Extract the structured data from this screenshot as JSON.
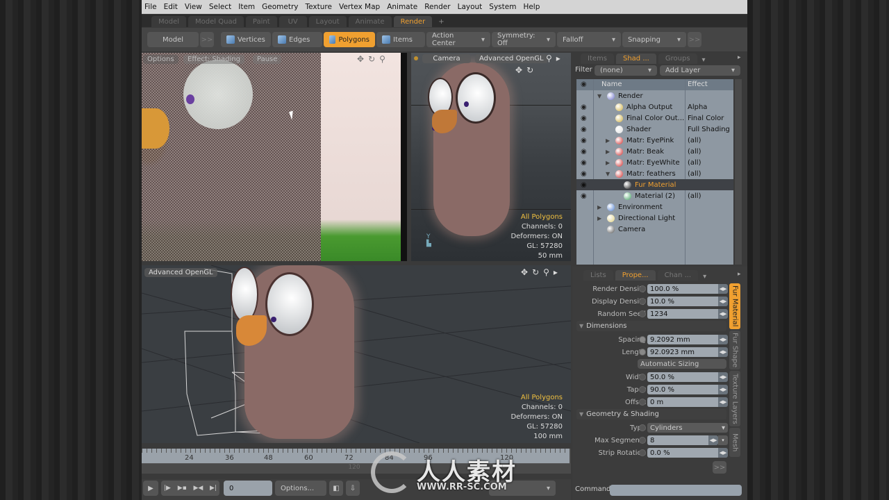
{
  "menu": [
    "File",
    "Edit",
    "View",
    "Select",
    "Item",
    "Geometry",
    "Texture",
    "Vertex Map",
    "Animate",
    "Render",
    "Layout",
    "System",
    "Help"
  ],
  "layout_tabs": [
    {
      "label": "Model",
      "active": false
    },
    {
      "label": "Model Quad",
      "active": false
    },
    {
      "label": "Paint",
      "active": false
    },
    {
      "label": "UV",
      "active": false
    },
    {
      "label": "Layout",
      "active": false
    },
    {
      "label": "Animate",
      "active": false
    },
    {
      "label": "Render",
      "active": true
    }
  ],
  "layout_tab_add": "+",
  "toolbar": {
    "model": "Model",
    "more": ">>",
    "vertices": "Vertices",
    "edges": "Edges",
    "polygons": "Polygons",
    "items": "Items",
    "action_center": "Action Center",
    "symmetry": "Symmetry: Off",
    "falloff": "Falloff",
    "snapping": "Snapping",
    "more2": ">>"
  },
  "preview_vp": {
    "options": "Options",
    "effect": "Effect: Shading",
    "pause": "Pause"
  },
  "camera_vp": {
    "camera": "Camera",
    "mode": "Advanced OpenGL",
    "hud": {
      "selection": "All Polygons",
      "channels": "Channels: 0",
      "deformers": "Deformers: ON",
      "gl": "GL: 57280",
      "scale": "50 mm"
    }
  },
  "persp_vp": {
    "mode": "Advanced OpenGL",
    "hud": {
      "selection": "All Polygons",
      "channels": "Channels: 0",
      "deformers": "Deformers: ON",
      "gl": "GL: 57280",
      "scale": "100 mm"
    }
  },
  "shader_panel": {
    "tabs": [
      {
        "label": "Items",
        "active": false
      },
      {
        "label": "Shad ...",
        "active": true
      },
      {
        "label": "Groups",
        "active": false
      }
    ],
    "filter_label": "Filter",
    "filter_value": "(none)",
    "add_layer": "Add Layer",
    "col_name": "Name",
    "col_effect": "Effect",
    "rows": [
      {
        "name": "Render",
        "effect": "",
        "indent": 0,
        "arrow": "▼",
        "icon": "#6a70c8",
        "eye": false,
        "sel": false
      },
      {
        "name": "Alpha Output",
        "effect": "Alpha",
        "indent": 1,
        "arrow": "",
        "icon": "#d0b040",
        "eye": true,
        "sel": false
      },
      {
        "name": "Final Color Out...",
        "effect": "Final Color",
        "indent": 1,
        "arrow": "",
        "icon": "#d0b040",
        "eye": true,
        "sel": false
      },
      {
        "name": "Shader",
        "effect": "Full Shading",
        "indent": 1,
        "arrow": "",
        "icon": "#e0e0e0",
        "eye": true,
        "sel": false
      },
      {
        "name": "Matr: EyePink",
        "effect": "(all)",
        "indent": 1,
        "arrow": "▶",
        "icon": "#d03030",
        "eye": true,
        "sel": false
      },
      {
        "name": "Matr: Beak",
        "effect": "(all)",
        "indent": 1,
        "arrow": "▶",
        "icon": "#d03030",
        "eye": true,
        "sel": false
      },
      {
        "name": "Matr: EyeWhite",
        "effect": "(all)",
        "indent": 1,
        "arrow": "▶",
        "icon": "#d03030",
        "eye": true,
        "sel": false
      },
      {
        "name": "Matr: feathers",
        "effect": "(all)",
        "indent": 1,
        "arrow": "▼",
        "icon": "#d03030",
        "eye": true,
        "sel": false
      },
      {
        "name": "Fur Material",
        "effect": "",
        "indent": 2,
        "arrow": "",
        "icon": "#222222",
        "eye": true,
        "sel": true
      },
      {
        "name": "Material (2)",
        "effect": "(all)",
        "indent": 2,
        "arrow": "",
        "icon": "#40a060",
        "eye": true,
        "sel": false
      },
      {
        "name": "Environment",
        "effect": "",
        "indent": 0,
        "arrow": "▶",
        "icon": "#5080d0",
        "eye": false,
        "sel": false
      },
      {
        "name": "Directional Light",
        "effect": "",
        "indent": 0,
        "arrow": "▶",
        "icon": "#e0d080",
        "eye": false,
        "sel": false
      },
      {
        "name": "Camera",
        "effect": "",
        "indent": 0,
        "arrow": "",
        "icon": "#555555",
        "eye": false,
        "sel": false
      }
    ]
  },
  "props_panel": {
    "tabs": [
      {
        "label": "Lists",
        "active": false
      },
      {
        "label": "Prope...",
        "active": true
      },
      {
        "label": "Chan ...",
        "active": false
      }
    ],
    "render_density": {
      "label": "Render Density",
      "value": "100.0 %"
    },
    "display_density": {
      "label": "Display Density",
      "value": "10.0 %"
    },
    "random_seed": {
      "label": "Random Seed",
      "value": "1234"
    },
    "dimensions": "Dimensions",
    "spacing": {
      "label": "Spacing",
      "value": "9.2092 mm"
    },
    "length": {
      "label": "Length",
      "value": "92.0923 mm"
    },
    "auto_sizing": "Automatic Sizing",
    "width": {
      "label": "Width",
      "value": "50.0 %"
    },
    "taper": {
      "label": "Taper",
      "value": "90.0 %"
    },
    "offset": {
      "label": "Offset",
      "value": "0 m"
    },
    "geom_shading": "Geometry & Shading",
    "type": {
      "label": "Type",
      "value": "Cylinders"
    },
    "max_segments": {
      "label": "Max Segments",
      "value": "8"
    },
    "strip_rotation": {
      "label": "Strip Rotation",
      "value": "0.0 %"
    },
    "more": ">>",
    "side_tabs": [
      {
        "label": "Fur Material",
        "active": true
      },
      {
        "label": "Fur Shape",
        "active": false
      },
      {
        "label": "Texture Layers",
        "active": false
      },
      {
        "label": "Mesh",
        "active": false
      }
    ]
  },
  "timeline": {
    "ticks": [
      "24",
      "36",
      "48",
      "60",
      "72",
      "84",
      "96",
      "120"
    ],
    "end_tick": "120",
    "range_end": "120"
  },
  "transport": {
    "frame": "0",
    "options": "Options..."
  },
  "command": {
    "label": "Command",
    "value": ""
  },
  "watermark": {
    "text": "人人素材",
    "url": "WWW.RR-SC.COM"
  }
}
